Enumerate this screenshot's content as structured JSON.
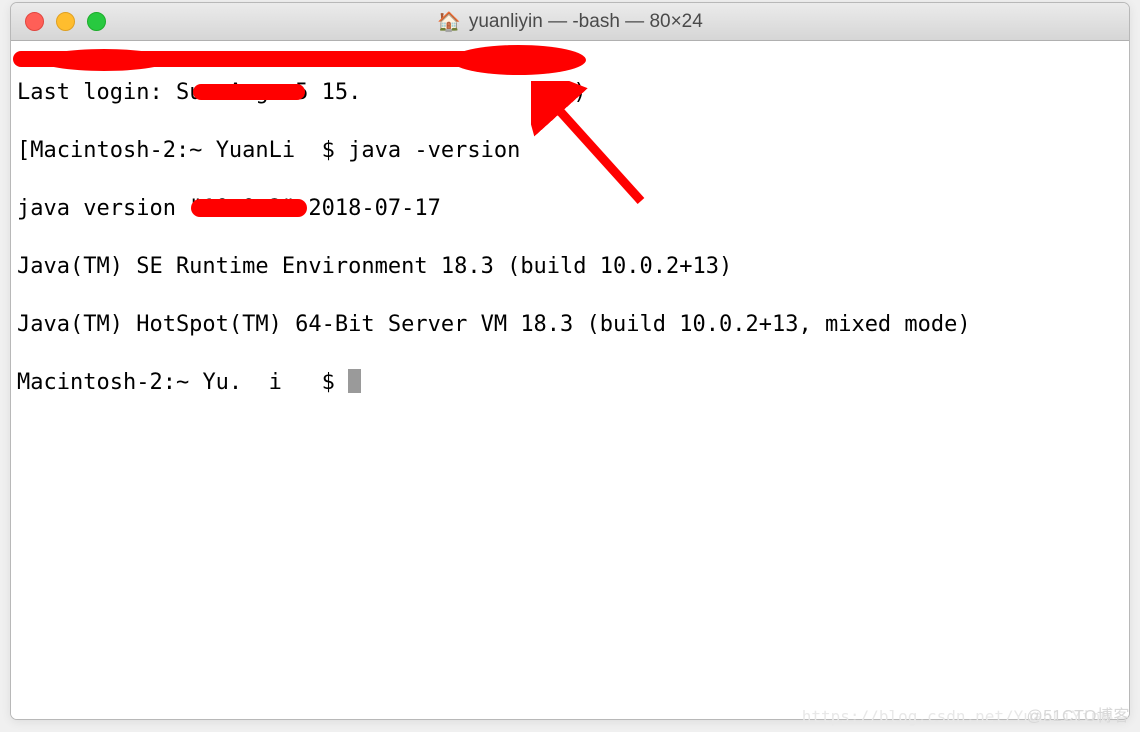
{
  "titlebar": {
    "title": "yuanliyin — -bash — 80×24",
    "home_icon": "🏠"
  },
  "terminal": {
    "line1_prefix": "Last login:",
    "line1_redacted_mid": " Sun Aug  5 15.",
    "line1_suffix": ")",
    "line2_prompt_prefix": "[Macintosh-2:~ ",
    "line2_redacted": "YuanLi",
    "line2_prompt_suffix": "$ ",
    "line2_command": "java -version",
    "line3": "java version \"10.0.2\" 2018-07-17",
    "line4": "Java(TM) SE Runtime Environment 18.3 (build 10.0.2+13)",
    "line5": "Java(TM) HotSpot(TM) 64-Bit Server VM 18.3 (build 10.0.2+13, mixed mode)",
    "line6_prompt_prefix": "Macintosh-2:~ ",
    "line6_redacted": "Yu.  i",
    "line6_prompt_suffix": "$ "
  },
  "watermark": {
    "text1": "@51CTO博客",
    "text2": "https://blog.csdn.net/YuanLiYin0"
  },
  "colors": {
    "annotation_red": "#ff0000",
    "close": "#ff5f57",
    "min": "#ffbd2e",
    "max": "#28c940"
  }
}
